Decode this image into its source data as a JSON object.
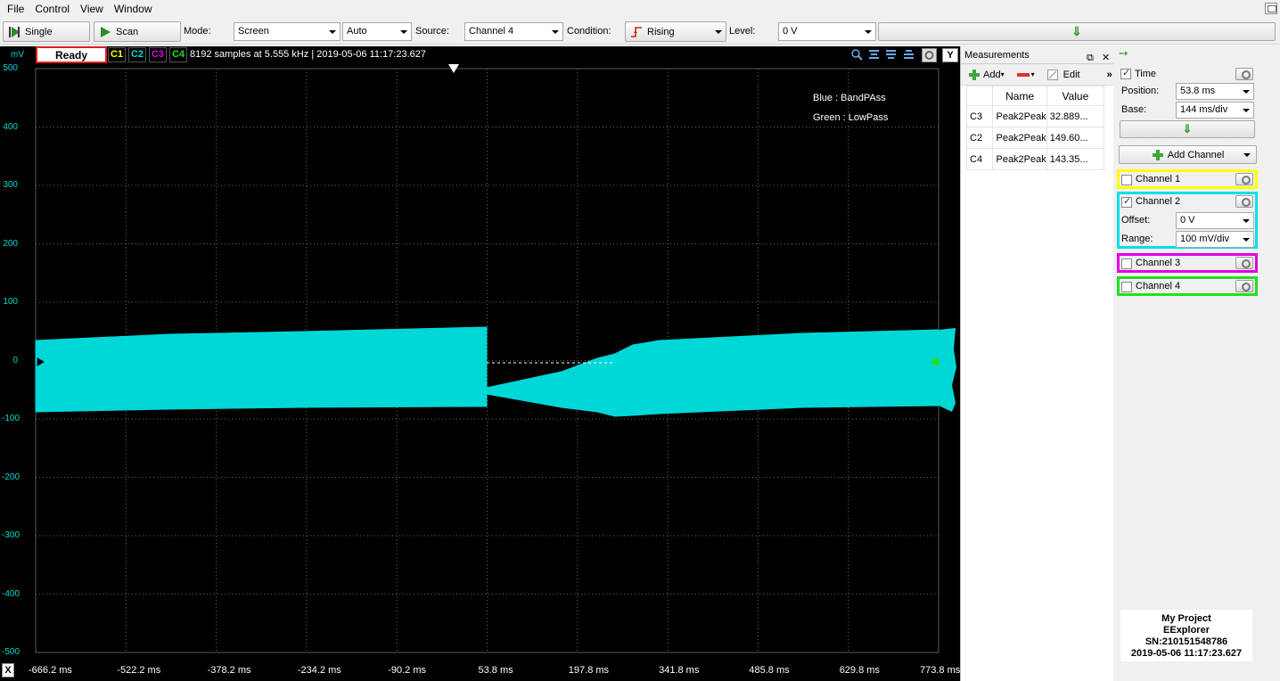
{
  "menu": [
    "File",
    "Control",
    "View",
    "Window"
  ],
  "toolbar": {
    "single_label": "Single",
    "scan_label": "Scan",
    "mode_label": "Mode:",
    "mode_value": "Screen",
    "auto_value": "Auto",
    "source_label": "Source:",
    "source_value": "Channel 4",
    "condition_label": "Condition:",
    "condition_value": "Rising",
    "level_label": "Level:",
    "level_value": "0 V",
    "level_bar_glyph": "⇓"
  },
  "scope": {
    "status": "Ready",
    "channel_tags": [
      {
        "label": "C1",
        "color": "#ffff00"
      },
      {
        "label": "C2",
        "color": "#00d8d8"
      },
      {
        "label": "C3",
        "color": "#e000e0"
      },
      {
        "label": "C4",
        "color": "#20e020"
      }
    ],
    "sample_info": "8192 samples at 5.555 kHz | 2019-05-06 11:17:23.627",
    "y_unit": "mV",
    "y_ticks": [
      "500",
      "400",
      "300",
      "200",
      "100",
      "0",
      "-100",
      "-200",
      "-300",
      "-400",
      "-500"
    ],
    "x_ticks": [
      "-666.2 ms",
      "-522.2 ms",
      "-378.2 ms",
      "-234.2 ms",
      "-90.2 ms",
      "53.8 ms",
      "197.8 ms",
      "341.8 ms",
      "485.8 ms",
      "629.8 ms",
      "773.8 ms"
    ],
    "x_button": "X",
    "y_button": "Y",
    "annotation_1": "Blue : BandPAss",
    "annotation_2": "Green : LowPass",
    "trace_color": "#00d8d8"
  },
  "measurements": {
    "title": "Measurements",
    "add_label": "Add",
    "edit_label": "Edit",
    "columns": [
      "",
      "Name",
      "Value"
    ],
    "rows": [
      {
        "ch": "C3",
        "name": "Peak2Peak",
        "value": "32.889..."
      },
      {
        "ch": "C2",
        "name": "Peak2Peak",
        "value": "149.60..."
      },
      {
        "ch": "C4",
        "name": "Peak2Peak",
        "value": "143.35..."
      }
    ]
  },
  "panel": {
    "time_label": "Time",
    "position_label": "Position:",
    "position_value": "53.8 ms",
    "base_label": "Base:",
    "base_value": "144 ms/div",
    "add_channel_label": "Add Channel",
    "channels": [
      {
        "name": "Channel 1",
        "checked": false,
        "color": "#ffff00"
      },
      {
        "name": "Channel 2",
        "checked": true,
        "color": "#00e0e8"
      },
      {
        "name": "Channel 3",
        "checked": false,
        "color": "#e000e0"
      },
      {
        "name": "Channel 4",
        "checked": false,
        "color": "#20e020"
      }
    ],
    "offset_label": "Offset:",
    "offset_value": "0 V",
    "range_label": "Range:",
    "range_value": "100 mV/div",
    "project_name": "My Project",
    "device_name": "EExplorer",
    "serial": "SN:210151548786",
    "timestamp": "2019-05-06 11:17:23.627"
  }
}
